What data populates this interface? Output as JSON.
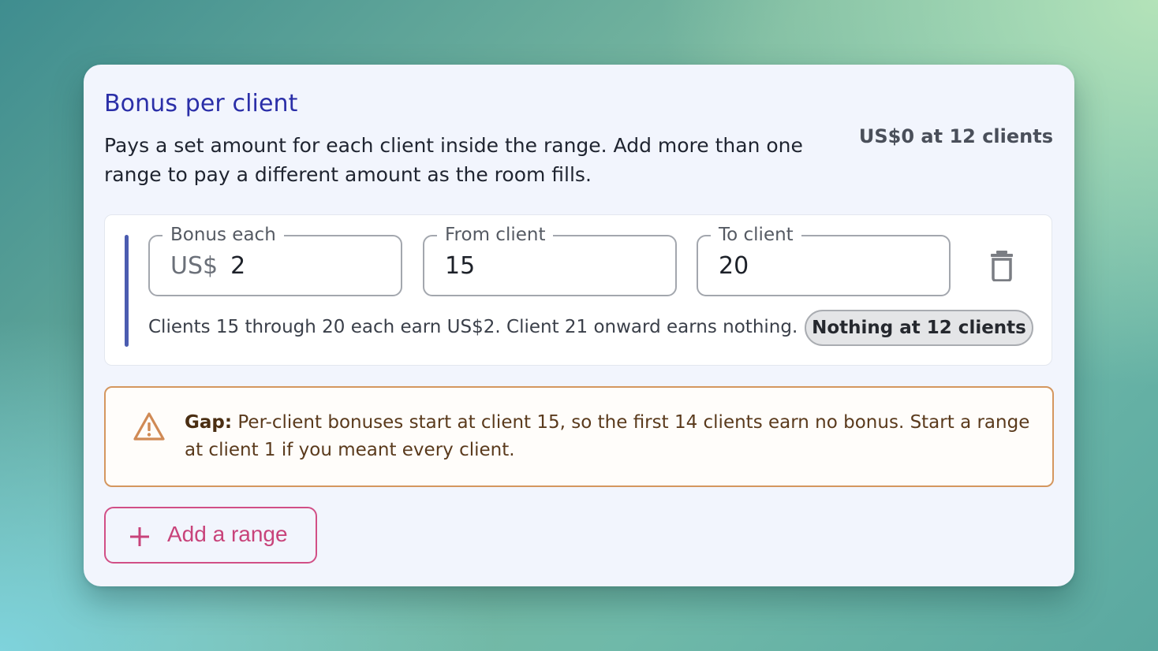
{
  "card": {
    "title": "Bonus per client",
    "description": "Pays a set amount for each client inside the range. Add more than one range to pay a different amount as the room fills.",
    "summary": "US$0 at 12 clients"
  },
  "range": {
    "bonus_each": {
      "label": "Bonus each",
      "prefix": "US$",
      "value": "2"
    },
    "from_client": {
      "label": "From client",
      "value": "15"
    },
    "to_client": {
      "label": "To client",
      "value": "20"
    },
    "delete_icon": "trash-icon",
    "explanation": "Clients 15 through 20 each earn US$2. Client 21 onward earns nothing.",
    "status_pill": "Nothing at 12 clients"
  },
  "warning": {
    "icon": "warning-triangle-icon",
    "label": "Gap:",
    "text": "Per-client bonuses start at client 15, so the first 14 clients earn no bonus. Start a range at client 1 if you meant every client."
  },
  "add_button": {
    "icon": "plus-icon",
    "label": "Add a range"
  },
  "colors": {
    "title": "#2b2fa8",
    "accent_bar": "#4b5cb0",
    "warning_border": "#d4975f",
    "add_button": "#c8437a"
  }
}
